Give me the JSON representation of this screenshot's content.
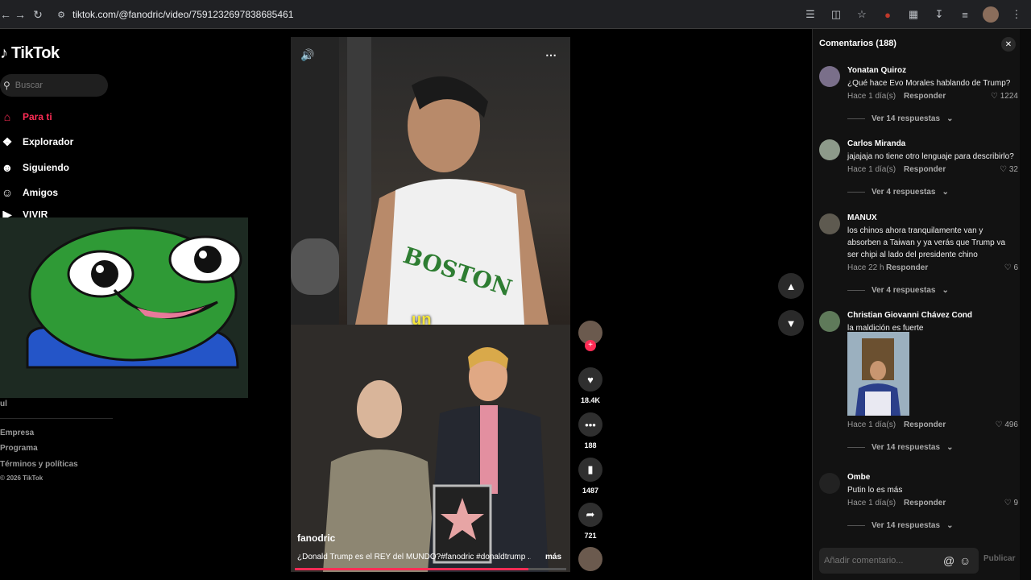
{
  "browser": {
    "url": "tiktok.com/@fanodric/video/7591232697838685461"
  },
  "sidebar": {
    "logo": "TikTok",
    "search_placeholder": "Buscar",
    "nav": [
      {
        "label": "Para ti",
        "icon": "home-icon"
      },
      {
        "label": "Explorador",
        "icon": "compass-icon"
      },
      {
        "label": "Siguiendo",
        "icon": "following-icon"
      },
      {
        "label": "Amigos",
        "icon": "friends-icon"
      },
      {
        "label": "VIVIR",
        "icon": "live-icon"
      }
    ],
    "footer": [
      "Empresa",
      "Programa",
      "Términos y políticas",
      "© 2026 TikTok"
    ],
    "partial_text": "ul"
  },
  "video": {
    "subtitle": "un",
    "author": "fanodric",
    "caption": "¿Donald Trump es el REY del MUNDO?#fanodric #donaldtrump ...",
    "more_label": "más",
    "progress": 0.86
  },
  "actions": {
    "likes": "18.4K",
    "comments": "188",
    "saves": "1487",
    "shares": "721"
  },
  "comments_panel": {
    "title": "Comentarios (188)",
    "comments": [
      {
        "user": "Yonatan Quiroz",
        "text": "¿Qué hace Evo Morales hablando de Trump?",
        "time": "Hace 1 día(s)",
        "reply": "Responder",
        "likes": "1224",
        "view_replies": "Ver 14 respuestas"
      },
      {
        "user": "Carlos Miranda",
        "text": "jajajaja no tiene otro lenguaje para describirlo?",
        "time": "Hace 1 día(s)",
        "reply": "Responder",
        "likes": "32",
        "view_replies": "Ver 4 respuestas"
      },
      {
        "user": "MANUX",
        "text": "los chinos ahora tranquilamente van y absorben a Taiwan y ya verás que Trump va ser chipi al lado del presidente chino",
        "time": "Hace 22 h",
        "reply": "Responder",
        "likes": "6",
        "view_replies": "Ver 4 respuestas"
      },
      {
        "user": "Christian Giovanni Chávez Cond",
        "text": "la maldición es fuerte",
        "time": "Hace 1 día(s)",
        "reply": "Responder",
        "likes": "496",
        "view_replies": "Ver 14 respuestas"
      },
      {
        "user": "Ombe",
        "text": "Putin lo es más",
        "time": "Hace 1 día(s)",
        "reply": "Responder",
        "likes": "9",
        "view_replies": "Ver 14 respuestas"
      }
    ],
    "add_placeholder": "Añadir comentario...",
    "publish_label": "Publicar"
  },
  "colors": {
    "accent": "#fe2c55",
    "subtitle": "#f4e63b",
    "panel_bg": "#121212"
  }
}
